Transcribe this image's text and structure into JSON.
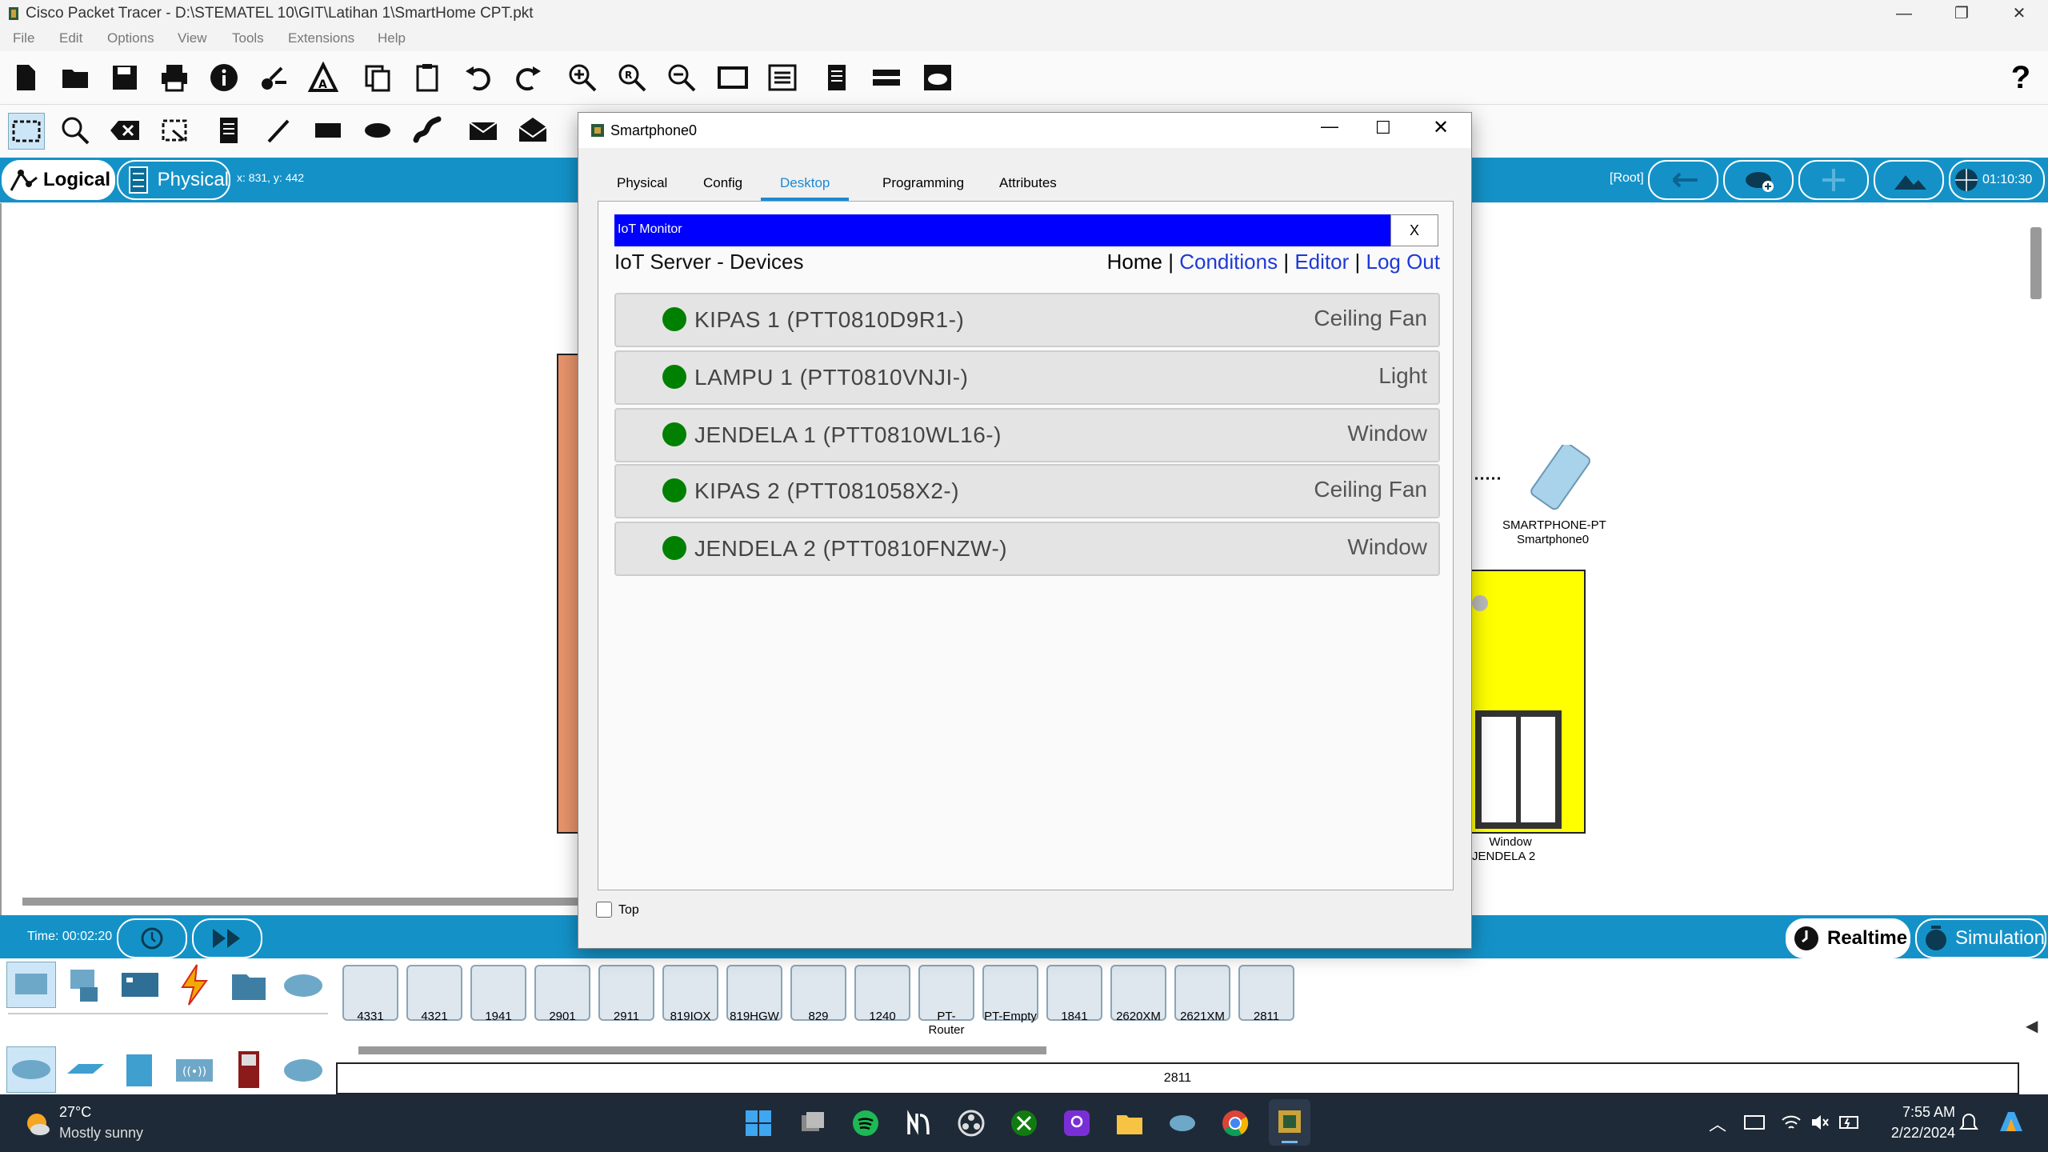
{
  "window": {
    "title": "Cisco Packet Tracer - D:\\STEMATEL 10\\GIT\\Latihan 1\\SmartHome CPT.pkt"
  },
  "menu": [
    "File",
    "Edit",
    "Options",
    "View",
    "Tools",
    "Extensions",
    "Help"
  ],
  "help_label": "?",
  "modes": {
    "logical": "Logical",
    "physical": "Physical",
    "coords": "x: 831, y: 442"
  },
  "top_right": {
    "root": "[Root]",
    "clock": "01:10:30"
  },
  "canvas": {
    "smartphone_label_1": "SMARTPHONE-PT",
    "smartphone_label_2": "Smartphone0",
    "window_label_1": "Window",
    "window_label_2": "JENDELA 2"
  },
  "status": {
    "time": "Time: 00:02:20",
    "realtime": "Realtime",
    "simulation": "Simulation"
  },
  "routers": [
    "4331",
    "4321",
    "1941",
    "2901",
    "2911",
    "819IOX",
    "819HGW",
    "829",
    "1240",
    "PT-Router",
    "PT-Empty",
    "1841",
    "2620XM",
    "2621XM",
    "2811"
  ],
  "selected_model": "2811",
  "dialog": {
    "title": "Smartphone0",
    "tabs": [
      "Physical",
      "Config",
      "Desktop",
      "Programming",
      "Attributes"
    ],
    "active_tab": "Desktop",
    "iot_monitor_title": "IoT Monitor",
    "close_x": "X",
    "server_title": "IoT Server - Devices",
    "nav": {
      "home": "Home",
      "sep": "|",
      "conditions": "Conditions",
      "editor": "Editor",
      "logout": "Log Out"
    },
    "devices": [
      {
        "name": "KIPAS 1 (PTT0810D9R1-)",
        "type": "Ceiling Fan",
        "status_color": "#008000"
      },
      {
        "name": "LAMPU 1 (PTT0810VNJI-)",
        "type": "Light",
        "status_color": "#008000"
      },
      {
        "name": "JENDELA 1 (PTT0810WL16-)",
        "type": "Window",
        "status_color": "#008000"
      },
      {
        "name": "KIPAS 2 (PTT081058X2-)",
        "type": "Ceiling Fan",
        "status_color": "#008000"
      },
      {
        "name": "JENDELA 2 (PTT0810FNZW-)",
        "type": "Window",
        "status_color": "#008000"
      }
    ],
    "top_checkbox_label": "Top"
  },
  "taskbar": {
    "weather_temp": "27°C",
    "weather_desc": "Mostly sunny",
    "time": "7:55 AM",
    "date": "2/22/2024"
  },
  "colors": {
    "accent_blue": "#1492c8",
    "iot_bar": "#0000ff",
    "status_green": "#008000",
    "link": "#1f39d6"
  }
}
